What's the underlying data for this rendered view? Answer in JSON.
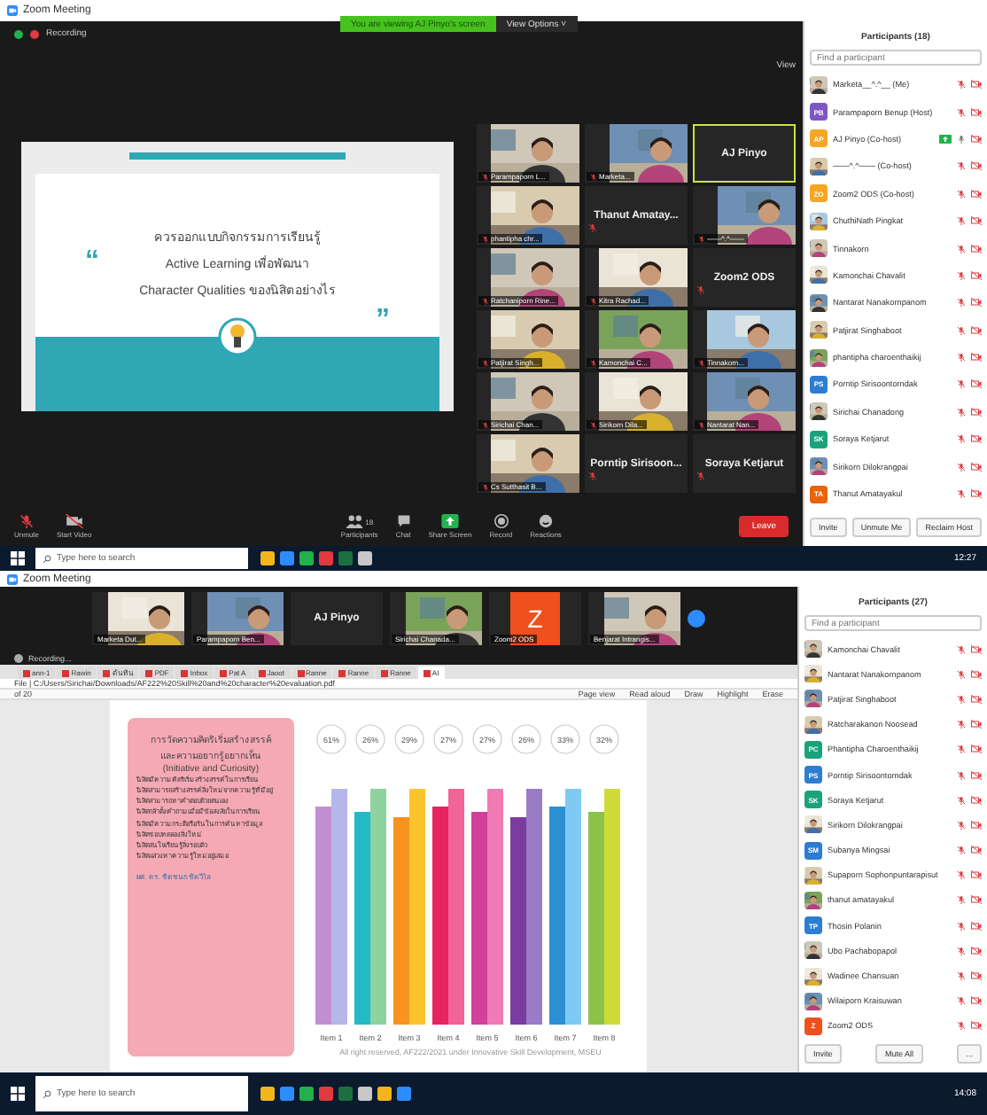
{
  "top": {
    "window": {
      "title": "Zoom Meeting"
    },
    "banner": {
      "text": "You are viewing AJ Pinyo's screen",
      "options": "View Options ˅"
    },
    "recording": "Recording",
    "slide": {
      "open_quote": "“",
      "close_quote": "”",
      "lines": [
        "ควรออกแบบกิจกรรมการเรียนรู้",
        "Active Learning เพื่อพัฒนา",
        "Character Qualities ของนิสิตอย่างไร"
      ]
    },
    "view_label": "View",
    "gallery": [
      {
        "kind": "video",
        "name": "Parampaporn L...",
        "active": false
      },
      {
        "kind": "avatar",
        "name": "Marketa...",
        "active": false
      },
      {
        "kind": "name",
        "name": "AJ Pinyo",
        "active": true
      },
      {
        "kind": "video",
        "name": "phantipha chr...",
        "active": false
      },
      {
        "kind": "name",
        "name": "Thanut Amatay...",
        "active": false
      },
      {
        "kind": "avatar",
        "name": "——^.^——",
        "active": false
      },
      {
        "kind": "video",
        "name": "Ratchaniporn Rine...",
        "active": false
      },
      {
        "kind": "video",
        "name": "Kitra Rachad...",
        "active": false
      },
      {
        "kind": "name",
        "name": "Zoom2 ODS",
        "active": false
      },
      {
        "kind": "video",
        "name": "Patjirat Singh...",
        "active": false
      },
      {
        "kind": "video",
        "name": "Kamonchai C...",
        "active": false
      },
      {
        "kind": "video",
        "name": "Tinnakorn...",
        "active": false
      },
      {
        "kind": "video",
        "name": "Sirichai Chan...",
        "active": false
      },
      {
        "kind": "video",
        "name": "Sirikorn Dila...",
        "active": false
      },
      {
        "kind": "video",
        "name": "Nantarat Nan...",
        "active": false
      },
      {
        "kind": "video",
        "name": "Cs Sutthasit B...",
        "active": false
      },
      {
        "kind": "name",
        "name": "Porntip Sirisoon...",
        "active": false
      },
      {
        "kind": "name",
        "name": "Soraya Ketjarut",
        "active": false
      }
    ],
    "toolbar": [
      {
        "kind": "mic",
        "label": "Unmute"
      },
      {
        "kind": "video",
        "label": "Start Video"
      },
      {
        "kind": "people",
        "label": "Participants",
        "count": "18"
      },
      {
        "kind": "chat",
        "label": "Chat"
      },
      {
        "kind": "share",
        "label": "Share Screen"
      },
      {
        "kind": "record",
        "label": "Record"
      },
      {
        "kind": "react",
        "label": "Reactions"
      }
    ],
    "leave": "Leave",
    "participants": {
      "title": "Participants (18)",
      "search": {
        "placeholder": "Find a participant"
      },
      "items": [
        {
          "name": "Marketa__^.^__ (Me)",
          "muted": true,
          "video_on": false,
          "sharing": false
        },
        {
          "name": "Parampaporn Benup (Host)",
          "avatar": {
            "kind": "initials",
            "initials": "PB",
            "color": "#7e57c2"
          },
          "muted": true,
          "video_on": false,
          "sharing": false
        },
        {
          "name": "AJ Pinyo (Co-host)",
          "avatar": {
            "kind": "initials",
            "initials": "AP",
            "color": "#f5a623"
          },
          "muted": false,
          "video_on": false,
          "sharing": true
        },
        {
          "name": "——^.^—— (Co-host)",
          "muted": true,
          "video_on": false,
          "sharing": false
        },
        {
          "name": "Zoom2 ODS (Co-host)",
          "avatar": {
            "kind": "initials",
            "initials": "ZO",
            "color": "#f5a623"
          },
          "muted": true,
          "video_on": false,
          "sharing": false
        },
        {
          "name": "ChuthiNath Pingkat",
          "muted": true,
          "video_on": false,
          "sharing": false
        },
        {
          "name": "Tinnakorn",
          "muted": true,
          "video_on": false,
          "sharing": false
        },
        {
          "name": "Kamonchai Chavalit",
          "muted": true,
          "video_on": false,
          "sharing": false
        },
        {
          "name": "Nantarat Nanakornpanom",
          "muted": true,
          "video_on": false,
          "sharing": false
        },
        {
          "name": "Patjirat Singhaboot",
          "muted": true,
          "video_on": false,
          "sharing": false
        },
        {
          "name": "phantipha charoenthaikij",
          "muted": true,
          "video_on": false,
          "sharing": false
        },
        {
          "name": "Porntip Sirisoontorndak",
          "avatar": {
            "kind": "initials",
            "initials": "PS",
            "color": "#2d7dd2"
          },
          "muted": true,
          "video_on": false,
          "sharing": false
        },
        {
          "name": "Sirichai Chanadong",
          "muted": true,
          "video_on": false,
          "sharing": false
        },
        {
          "name": "Soraya Ketjarut",
          "avatar": {
            "kind": "initials",
            "initials": "SK",
            "color": "#1aa37a"
          },
          "muted": true,
          "video_on": false,
          "sharing": false
        },
        {
          "name": "Sirikorn Dilokrangpai",
          "muted": true,
          "video_on": false,
          "sharing": false
        },
        {
          "name": "Thanut Amatayakul",
          "avatar": {
            "kind": "initials",
            "initials": "TA",
            "color": "#e8630a"
          },
          "muted": true,
          "video_on": false,
          "sharing": false
        }
      ],
      "buttons": [
        "Invite",
        "Unmute Me",
        "Reclaim Host"
      ]
    },
    "taskbar": {
      "search": "Type here to search",
      "time": "12:27"
    }
  },
  "bottom": {
    "window": {
      "title": "Zoom Meeting"
    },
    "strip": [
      {
        "kind": "video",
        "name": "Marketa Dut..."
      },
      {
        "kind": "video",
        "name": "Parampaporn Ben..."
      },
      {
        "kind": "name",
        "name": "AJ Pinyo"
      },
      {
        "kind": "video",
        "name": "Sirichai Chanada..."
      },
      {
        "kind": "letter",
        "letter": "Z",
        "name": "Zoom2 ODS"
      },
      {
        "kind": "video",
        "name": "Benjarat Intrangis..."
      }
    ],
    "recording": "Recording...",
    "browser": {
      "tabs": [
        {
          "label": "ann-1",
          "selected": false
        },
        {
          "label": "Rawin",
          "selected": false
        },
        {
          "label": "ต้นทิน",
          "selected": false
        },
        {
          "label": "PDF",
          "selected": false
        },
        {
          "label": "Inbox",
          "selected": false
        },
        {
          "label": "Pat A",
          "selected": false
        },
        {
          "label": "Jaoot",
          "selected": false
        },
        {
          "label": "Ranne",
          "selected": false
        },
        {
          "label": "Ranne",
          "selected": false
        },
        {
          "label": "Ranne",
          "selected": false
        },
        {
          "label": "AI",
          "selected": true
        }
      ],
      "address": "File | C:/Users/Sirichai/Downloads/AF222%20Skill%20and%20character%20evaluation.pdf",
      "page": "of 20",
      "tools": [
        "Page view",
        "Read aloud",
        "Draw",
        "Highlight",
        "Erase"
      ]
    },
    "card": {
      "title": [
        "การวัดความคิดริเริ่มสร้างสรรค์",
        "และความอยากรู้อยากเห็น",
        "(Initiative and Curiosity)"
      ],
      "items": [
        "นิสิตมีความคิดริเริ่มสร้างสรรค์ในการเรียน",
        "นิสิตสามารถสร้างสรรค์สิ่งใหม่จากความรู้ที่มีอยู่",
        "นิสิตสามารถหาคำตอบด้วยตนเอง",
        "นิสิตกล้าตั้งคำถามเมื่อมีข้อสงสัยในการเรียน",
        "นิสิตมีความกระตือรือร้นในการค้นหาข้อมูล",
        "นิสิตชอบทดลองสิ่งใหม่",
        "นิสิตสนใจเรียนรู้สิ่งรอบตัว",
        "นิสิตแสวงหาความรู้ใหม่อยู่เสมอ"
      ],
      "footer": "ผศ. ดร. ชิดชนก ชิดวิไล"
    },
    "chart": {
      "items": [
        {
          "label": "Item 1",
          "percent": "61%",
          "bars": [
            {
              "color": "#c48fd2"
            },
            {
              "color": "#b5b6ea"
            }
          ]
        },
        {
          "label": "Item 2",
          "percent": "26%",
          "bars": [
            {
              "color": "#23b9c6"
            },
            {
              "color": "#8ed2a0"
            }
          ]
        },
        {
          "label": "Item 3",
          "percent": "29%",
          "bars": [
            {
              "color": "#f7931e"
            },
            {
              "color": "#fbc42d"
            }
          ]
        },
        {
          "label": "Item 4",
          "percent": "27%",
          "bars": [
            {
              "color": "#e8245f"
            },
            {
              "color": "#f06497"
            }
          ]
        },
        {
          "label": "Item 5",
          "percent": "27%",
          "bars": [
            {
              "color": "#d0409c"
            },
            {
              "color": "#f07ab3"
            }
          ]
        },
        {
          "label": "Item 6",
          "percent": "26%",
          "bars": [
            {
              "color": "#7a3ca0"
            },
            {
              "color": "#9a7cc6"
            }
          ]
        },
        {
          "label": "Item 7",
          "percent": "33%",
          "bars": [
            {
              "color": "#2c8fd4"
            },
            {
              "color": "#7fcaf2"
            }
          ]
        },
        {
          "label": "Item 8",
          "percent": "32%",
          "bars": [
            {
              "color": "#8bc34a"
            },
            {
              "color": "#cddc39"
            }
          ]
        }
      ],
      "credit": "All right reserved, AF222/2021 under Innovative Skill Development, MSEU"
    },
    "participants": {
      "title": "Participants (27)",
      "search": {
        "placeholder": "Find a participant"
      },
      "items": [
        {
          "name": "Kamonchai Chavalit",
          "muted": true,
          "video_on": false
        },
        {
          "name": "Nantarat Nanakornpanom",
          "muted": true,
          "video_on": false
        },
        {
          "name": "Patjirat Singhaboot",
          "muted": true,
          "video_on": false
        },
        {
          "name": "Ratcharakanon Noosead",
          "muted": true,
          "video_on": false
        },
        {
          "name": "Phantipha Charoenthaikij",
          "avatar": {
            "kind": "initials",
            "initials": "PC",
            "color": "#1aa37a"
          },
          "muted": true,
          "video_on": false
        },
        {
          "name": "Porntip Sirisoontorndak",
          "avatar": {
            "kind": "initials",
            "initials": "PS",
            "color": "#2d7dd2"
          },
          "muted": true,
          "video_on": false
        },
        {
          "name": "Soraya Ketjarut",
          "avatar": {
            "kind": "initials",
            "initials": "SK",
            "color": "#1aa37a"
          },
          "muted": true,
          "video_on": false
        },
        {
          "name": "Sirikorn Dilokrangpai",
          "muted": true,
          "video_on": false
        },
        {
          "name": "Subanya Mingsai",
          "avatar": {
            "kind": "initials",
            "initials": "SM",
            "color": "#2d7dd2"
          },
          "muted": true,
          "video_on": false
        },
        {
          "name": "Supaporn Sophonpuntarapisut",
          "muted": true,
          "video_on": false
        },
        {
          "name": "thanut amatayakul",
          "muted": true,
          "video_on": false
        },
        {
          "name": "Thosin Polanin",
          "avatar": {
            "kind": "initials",
            "initials": "TP",
            "color": "#2d7dd2"
          },
          "muted": true,
          "video_on": false
        },
        {
          "name": "Ubo Pachabopapol",
          "muted": true,
          "video_on": false
        },
        {
          "name": "Wadinee Chansuan",
          "muted": true,
          "video_on": false
        },
        {
          "name": "Wilaiporn Kraisuwan",
          "muted": true,
          "video_on": false
        },
        {
          "name": "Zoom2 ODS",
          "avatar": {
            "kind": "initials",
            "initials": "Z",
            "color": "#f0501e"
          },
          "muted": true,
          "video_on": false
        }
      ],
      "buttons": [
        "Invite",
        "Mute All",
        "..."
      ]
    },
    "taskbar": {
      "search": "Type here to search",
      "time": "14:08"
    }
  }
}
